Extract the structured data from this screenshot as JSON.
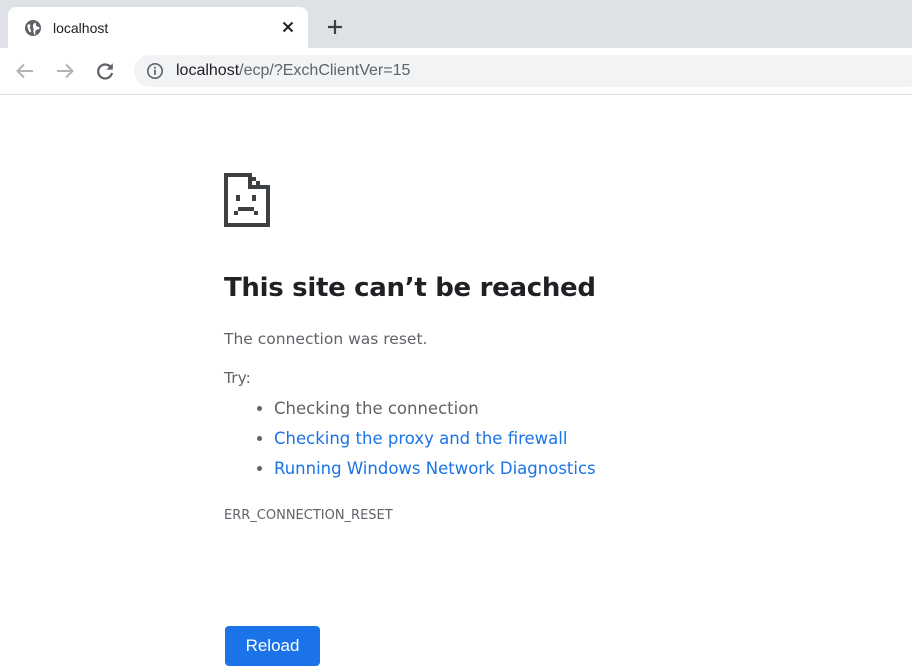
{
  "browser": {
    "tab": {
      "title": "localhost",
      "favicon": "globe-icon"
    },
    "new_tab": "plus-icon",
    "toolbar": {
      "back": "arrow-left-icon",
      "forward": "arrow-right-icon",
      "reload": "reload-icon",
      "site_info": "info-icon",
      "url_host": "localhost",
      "url_path": "/ecp/?ExchClientVer=15"
    }
  },
  "error": {
    "icon": "sad-document-icon",
    "title": "This site can’t be reached",
    "description": "The connection was reset.",
    "try_label": "Try:",
    "suggestions": [
      {
        "text": "Checking the connection",
        "link": false
      },
      {
        "text": "Checking the proxy and the firewall",
        "link": true
      },
      {
        "text": "Running Windows Network Diagnostics",
        "link": true
      }
    ],
    "code": "ERR_CONNECTION_RESET",
    "reload_label": "Reload"
  },
  "colors": {
    "link": "#1a73e8",
    "button": "#1a73e8",
    "text": "#202124",
    "secondary_text": "#5f6368",
    "tabstrip": "#dee1e6"
  }
}
